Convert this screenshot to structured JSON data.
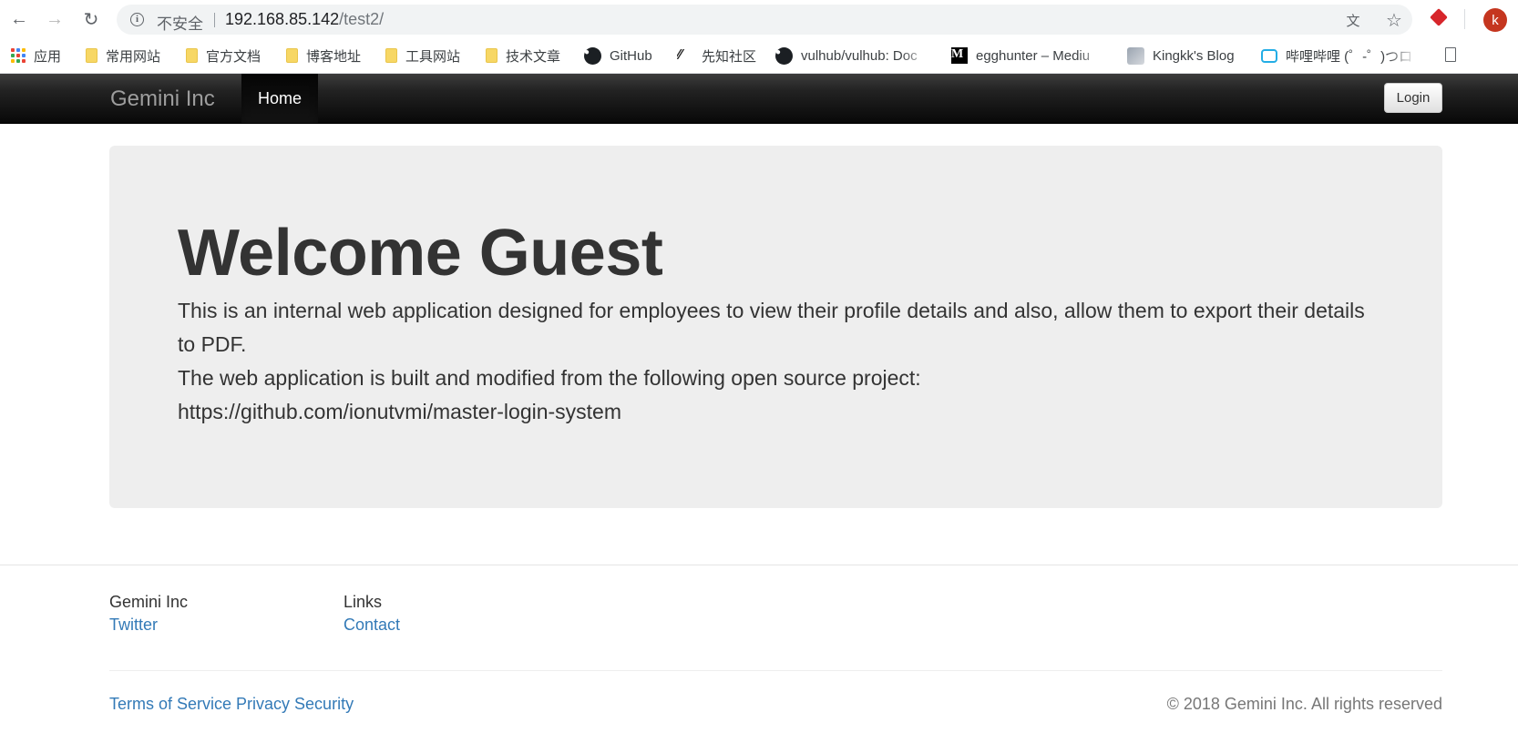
{
  "browser": {
    "insecure_label": "不安全",
    "url_host": "192.168.85.142",
    "url_path": "/test2/",
    "avatar_initial": "k"
  },
  "bookmarks": [
    {
      "label": "应用",
      "icon": "apps-icon"
    },
    {
      "label": "常用网站",
      "icon": "folder-icon"
    },
    {
      "label": "官方文档",
      "icon": "folder-icon"
    },
    {
      "label": "博客地址",
      "icon": "folder-icon"
    },
    {
      "label": "工具网站",
      "icon": "folder-icon"
    },
    {
      "label": "技术文章",
      "icon": "folder-icon"
    },
    {
      "label": "GitHub",
      "icon": "github-icon"
    },
    {
      "label": "先知社区",
      "icon": "xianzhi-icon"
    },
    {
      "label": "vulhub/vulhub: Doc",
      "icon": "github-icon"
    },
    {
      "label": "egghunter – Mediu",
      "icon": "medium-icon"
    },
    {
      "label": "Kingkk's Blog",
      "icon": "blog-avatar-icon"
    },
    {
      "label": "哔哩哔哩 (゜-゜)つロ",
      "icon": "bilibili-icon"
    }
  ],
  "navbar": {
    "brand": "Gemini Inc",
    "active_item": "Home",
    "login_label": "Login"
  },
  "jumbotron": {
    "title": "Welcome Guest",
    "paragraph_1": "This is an internal web application designed for employees to view their profile details and also, allow them to export their details to PDF.",
    "paragraph_2": "The web application is built and modified from the following open source project:",
    "paragraph_3": "https://github.com/ionutvmi/master-login-system"
  },
  "footer": {
    "col1_heading": "Gemini Inc",
    "col1_link": "Twitter",
    "col2_heading": "Links",
    "col2_link": "Contact",
    "legal_links": "Terms of Service Privacy Security",
    "copyright": "© 2018 Gemini Inc. All rights reserved"
  },
  "colors": {
    "link": "#337ab7",
    "navbar": "#222222",
    "jumbotron_bg": "#eeeeee"
  }
}
